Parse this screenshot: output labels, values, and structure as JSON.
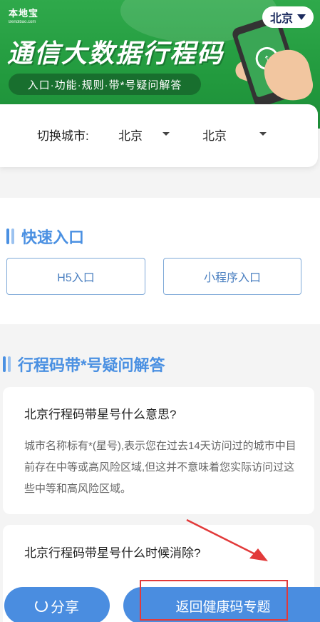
{
  "banner": {
    "logo_main": "本地宝",
    "logo_sub": "Bendibao.com",
    "city": "北京",
    "title": "通信大数据行程码",
    "tagline": "入口·功能·规则·带*号疑问解答"
  },
  "switcher": {
    "label": "切换城市:",
    "province": "北京",
    "city": "北京"
  },
  "quick": {
    "title": "快速入口",
    "h5_label": "H5入口",
    "mini_label": "小程序入口"
  },
  "faq": {
    "title": "行程码带*号疑问解答",
    "items": [
      {
        "question": "北京行程码带星号什么意思?",
        "answer": "城市名称标有*(星号),表示您在过去14天访问过的城市中目前存在中等或高风险区域,但这并不意味着您实际访问过这些中等和高风险区域。"
      },
      {
        "question": "北京行程码带星号什么时候消除?"
      }
    ]
  },
  "bottom": {
    "share_label": "分享",
    "back_label": "返回健康码专题"
  },
  "colors": {
    "banner_green": "#229a3e",
    "accent_blue": "#4a90e2",
    "annotation_red": "#e23a3a"
  }
}
